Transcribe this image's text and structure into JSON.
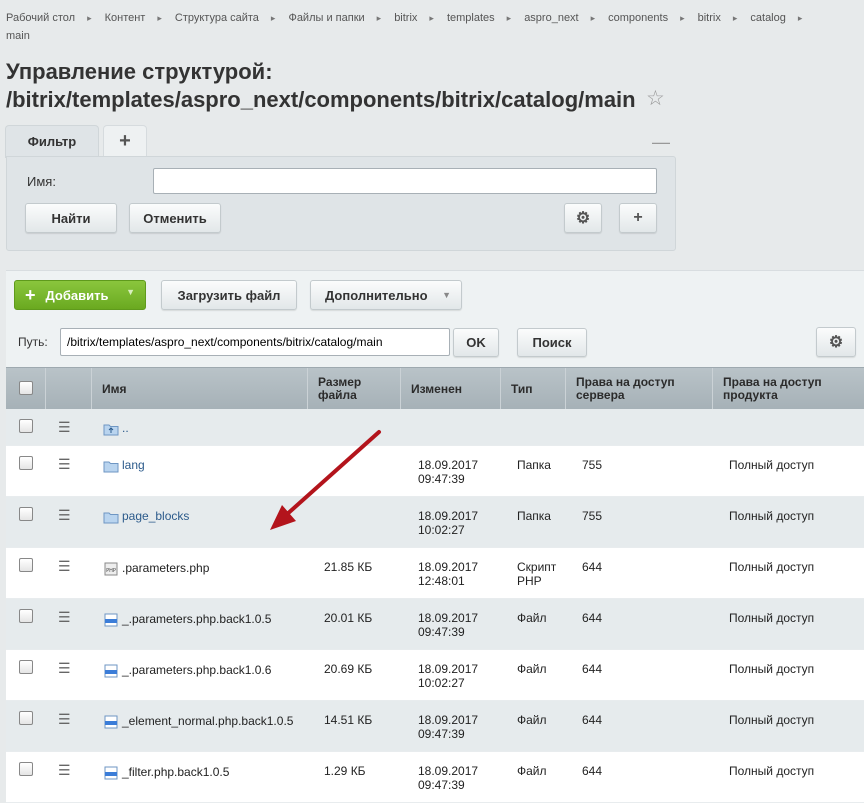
{
  "breadcrumbs": [
    "Рабочий стол",
    "Контент",
    "Структура сайта",
    "Файлы и папки",
    "bitrix",
    "templates",
    "aspro_next",
    "components",
    "bitrix",
    "catalog",
    "main"
  ],
  "page_title_line1": "Управление структурой:",
  "page_title_line2": "/bitrix/templates/aspro_next/components/bitrix/catalog/main",
  "filter": {
    "tab_label": "Фильтр",
    "add_tab": "+",
    "minimize": "—",
    "name_label": "Имя:",
    "name_value": "",
    "find_button": "Найти",
    "cancel_button": "Отменить",
    "settings_icon": "⚙",
    "add_icon": "+"
  },
  "toolbar": {
    "add_button": "Добавить",
    "upload_button": "Загрузить файл",
    "more_button": "Дополнительно"
  },
  "path_bar": {
    "label": "Путь:",
    "value": "/bitrix/templates/aspro_next/components/bitrix/catalog/main",
    "ok_button": "OK",
    "search_button": "Поиск"
  },
  "table": {
    "columns": [
      "Имя",
      "Размер файла",
      "Изменен",
      "Тип",
      "Права на доступ сервера",
      "Права на доступ продукта"
    ],
    "rows": [
      {
        "name": "..",
        "icon": "folder-up-icon",
        "size": "",
        "date": "",
        "time": "",
        "type": "",
        "type2": "",
        "server": "",
        "product": ""
      },
      {
        "name": "lang",
        "icon": "folder-icon",
        "size": "",
        "date": "18.09.2017",
        "time": "09:47:39",
        "type": "Папка",
        "type2": "",
        "server": "755",
        "product": "Полный доступ"
      },
      {
        "name": "page_blocks",
        "icon": "folder-icon",
        "size": "",
        "date": "18.09.2017",
        "time": "10:02:27",
        "type": "Папка",
        "type2": "",
        "server": "755",
        "product": "Полный доступ"
      },
      {
        "name": ".parameters.php",
        "icon": "php-file-icon",
        "size": "21.85 КБ",
        "date": "18.09.2017",
        "time": "12:48:01",
        "type": "Скрипт",
        "type2": "PHP",
        "server": "644",
        "product": "Полный доступ"
      },
      {
        "name": "_.parameters.php.back1.0.5",
        "icon": "file-icon",
        "size": "20.01 КБ",
        "date": "18.09.2017",
        "time": "09:47:39",
        "type": "Файл",
        "type2": "",
        "server": "644",
        "product": "Полный доступ"
      },
      {
        "name": "_.parameters.php.back1.0.6",
        "icon": "file-icon",
        "size": "20.69 КБ",
        "date": "18.09.2017",
        "time": "10:02:27",
        "type": "Файл",
        "type2": "",
        "server": "644",
        "product": "Полный доступ"
      },
      {
        "name": "_element_normal.php.back1.0.5",
        "icon": "file-icon",
        "size": "14.51 КБ",
        "date": "18.09.2017",
        "time": "09:47:39",
        "type": "Файл",
        "type2": "",
        "server": "644",
        "product": "Полный доступ"
      },
      {
        "name": "_filter.php.back1.0.5",
        "icon": "file-icon",
        "size": "1.29 КБ",
        "date": "18.09.2017",
        "time": "09:47:39",
        "type": "Файл",
        "type2": "",
        "server": "644",
        "product": "Полный доступ"
      }
    ]
  },
  "colors": {
    "accent_green": "#6aa920",
    "annotation_arrow": "#b3141c",
    "link": "#2b5a8b"
  }
}
